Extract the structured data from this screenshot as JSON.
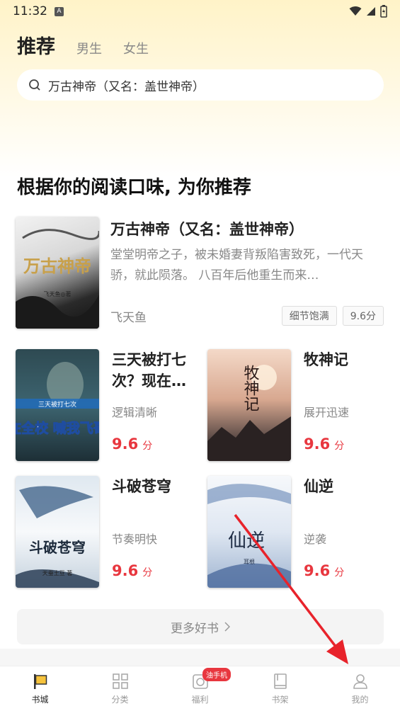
{
  "status": {
    "time": "11:32"
  },
  "tabs": [
    {
      "label": "推荐"
    },
    {
      "label": "男生"
    },
    {
      "label": "女生"
    }
  ],
  "search": {
    "value": "万古神帝（又名：盖世神帝）"
  },
  "section": {
    "title": "根据你的阅读口味, 为你推荐"
  },
  "featured": {
    "cover_title": "万古神帝",
    "cover_author": "飞天鱼◎著",
    "title": "万古神帝（又名：盖世神帝）",
    "desc": "堂堂明帝之子，被未婚妻背叛陷害致死，一代天骄，就此陨落。 八百年后他重生而来…",
    "author": "飞天鱼",
    "tags": [
      "细节饱满",
      "9.6分"
    ]
  },
  "books": [
    {
      "title": "三天被打七次？现在…",
      "sub": "逻辑清晰",
      "score": "9.6",
      "unit": "分",
      "cover_text": "现在全校 喊我飞哥！",
      "cover_small": "三天被打七次"
    },
    {
      "title": "牧神记",
      "sub": "展开迅速",
      "score": "9.6",
      "unit": "分",
      "cover_text": "牧神记"
    },
    {
      "title": "斗破苍穹",
      "sub": "节奏明快",
      "score": "9.6",
      "unit": "分",
      "cover_text": "斗破苍穹",
      "cover_small": "天蚕土豆 著"
    },
    {
      "title": "仙逆",
      "sub": "逆袭",
      "score": "9.6",
      "unit": "分",
      "cover_text": "仙逆",
      "cover_small": "耳根"
    }
  ],
  "more": {
    "label": "更多好书"
  },
  "nav": {
    "items": [
      {
        "label": "书城"
      },
      {
        "label": "分类"
      },
      {
        "label": "福利"
      },
      {
        "label": "书架"
      },
      {
        "label": "我的"
      }
    ],
    "badge": "油手机"
  },
  "colors": {
    "accent": "#e8373f",
    "search_bg": "#fff3c8"
  }
}
